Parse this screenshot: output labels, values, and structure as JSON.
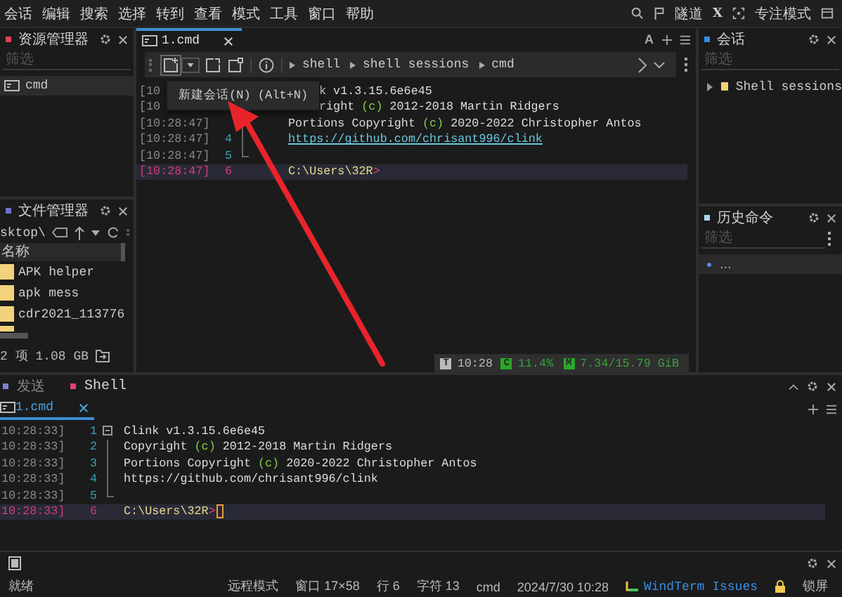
{
  "menu": [
    "会话",
    "编辑",
    "搜索",
    "选择",
    "转到",
    "查看",
    "模式",
    "工具",
    "窗口",
    "帮助"
  ],
  "title_bar": {
    "tunnel": "隧道",
    "x": "X",
    "focus_mode": "专注模式"
  },
  "explorer": {
    "title": "资源管理器",
    "filter_placeholder": "筛选",
    "items": [
      {
        "label": "cmd",
        "selected": true
      }
    ]
  },
  "file_manager": {
    "title": "文件管理器",
    "path": "sktop\\",
    "column": "名称",
    "rows": [
      {
        "name": "APK helper"
      },
      {
        "name": "apk mess"
      },
      {
        "name": "cdr2021_113776"
      }
    ],
    "footer": "2 项 1.08 GB"
  },
  "editor": {
    "tabs": [
      {
        "label": "1.cmd",
        "selected": true
      }
    ],
    "font_button": "A",
    "breadcrumb": [
      "shell",
      "shell sessions",
      "cmd"
    ],
    "tooltip": "新建会话(N) (Alt+N)",
    "lines": [
      {
        "kind": "covered",
        "time": "[10",
        "current": false,
        "segments": [
          {
            "kind": "plain",
            "text": "k v1.3.15.6e6e45"
          }
        ]
      },
      {
        "kind": "covered",
        "time": "[10",
        "current": false,
        "segments": [
          {
            "kind": "plain",
            "text": "right "
          },
          {
            "kind": "symbol",
            "text": "(c)"
          },
          {
            "kind": "plain",
            "text": " 2012-2018 Martin Ridgers"
          }
        ]
      },
      {
        "kind": "fold-body",
        "time": "[10:28:47]",
        "current": false,
        "segments": [
          {
            "kind": "plain",
            "text": "Portions Copyright "
          },
          {
            "kind": "symbol",
            "text": "(c)"
          },
          {
            "kind": "plain",
            "text": " 2020-2022 Christopher Antos"
          }
        ]
      },
      {
        "kind": "fold-body",
        "time": "[10:28:47]",
        "number": "4",
        "current": false,
        "segments": [
          {
            "kind": "link",
            "text": "https://github.com/chrisant996/clink"
          }
        ]
      },
      {
        "kind": "fold-end",
        "time": "[10:28:47]",
        "number": "5",
        "current": false
      },
      {
        "kind": "plain",
        "time": "[10:28:47]",
        "number": "6",
        "current": true,
        "segments": [
          {
            "kind": "prompt",
            "text": "C:\\Users\\32R"
          },
          {
            "kind": "symbol2",
            "text": ">"
          }
        ]
      }
    ],
    "meters": [
      {
        "kind": "time",
        "badge": "T",
        "value": "10:28"
      },
      {
        "kind": "cpu",
        "badge": "C",
        "value": "11.4%"
      },
      {
        "kind": "memory",
        "badge": "M",
        "value": "7.34/15.79 GiB"
      }
    ]
  },
  "sessions": {
    "title": "会话",
    "filter_placeholder": "筛选",
    "items": [
      {
        "label": "Shell sessions",
        "expanded": false
      }
    ]
  },
  "history": {
    "title": "历史命令",
    "filter_placeholder": "筛选",
    "items": [
      {
        "label": "...",
        "selected": true
      }
    ]
  },
  "bottom": {
    "tabs": [
      {
        "label": "发送",
        "selected": false,
        "color": "#7b7fd6"
      },
      {
        "label": "Shell",
        "selected": true,
        "color": "#e8407c"
      }
    ],
    "subtabs": [
      {
        "label": "1.cmd",
        "selected": true
      }
    ],
    "lines": [
      {
        "kind": "fold-start",
        "time": "10:28:33]",
        "number": "1",
        "current": false,
        "segments": [
          {
            "kind": "plain",
            "text": "Clink v1.3.15.6e6e45"
          }
        ]
      },
      {
        "kind": "fold-body",
        "time": "10:28:33]",
        "number": "2",
        "current": false,
        "segments": [
          {
            "kind": "plain",
            "text": "Copyright "
          },
          {
            "kind": "symbol",
            "text": "(c)"
          },
          {
            "kind": "plain",
            "text": " 2012-2018 Martin Ridgers"
          }
        ]
      },
      {
        "kind": "fold-body",
        "time": "10:28:33]",
        "number": "3",
        "current": false,
        "segments": [
          {
            "kind": "plain",
            "text": "Portions Copyright "
          },
          {
            "kind": "symbol",
            "text": "(c)"
          },
          {
            "kind": "plain",
            "text": " 2020-2022 Christopher Antos"
          }
        ]
      },
      {
        "kind": "fold-body",
        "time": "10:28:33]",
        "number": "4",
        "current": false,
        "segments": [
          {
            "kind": "plain",
            "text": "https://github.com/chrisant996/clink"
          }
        ]
      },
      {
        "kind": "fold-end",
        "time": "10:28:33]",
        "number": "5",
        "current": false
      },
      {
        "kind": "plain",
        "time": "10:28:33]",
        "number": "6",
        "current": true,
        "cursor": true,
        "segments": [
          {
            "kind": "prompt",
            "text": "C:\\Users\\32R"
          },
          {
            "kind": "symbol2",
            "text": ">"
          }
        ]
      }
    ]
  },
  "status_bar": [
    {
      "kind": "text",
      "text": "就绪"
    },
    {
      "kind": "spacer"
    },
    {
      "kind": "text",
      "text": "远程模式"
    },
    {
      "kind": "text",
      "text": "窗口 17×58"
    },
    {
      "kind": "text",
      "text": "行 6"
    },
    {
      "kind": "text",
      "text": "字符 13"
    },
    {
      "kind": "text",
      "text": "cmd"
    },
    {
      "kind": "text",
      "text": "2024/7/30 10:28"
    },
    {
      "kind": "link",
      "text": "WindTerm Issues"
    },
    {
      "kind": "lock",
      "text": "锁屏"
    }
  ]
}
